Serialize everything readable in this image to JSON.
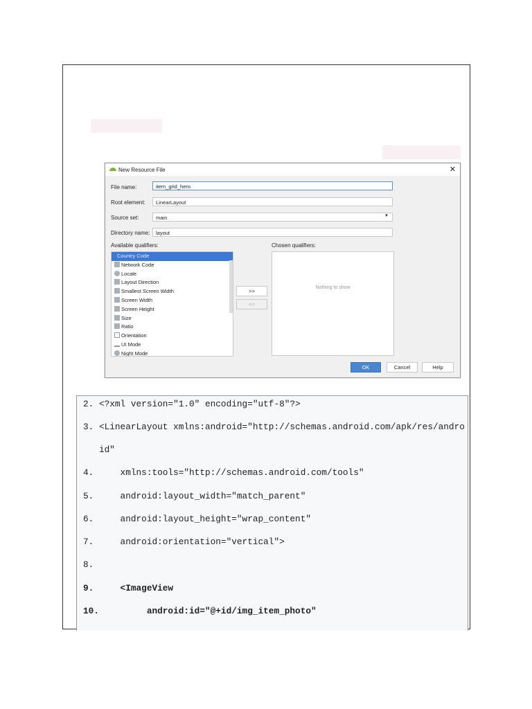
{
  "dialog": {
    "title": "New Resource File",
    "fields": [
      {
        "label": "File name:",
        "value": "item_grid_hero"
      },
      {
        "label": "Root element:",
        "value": "LinearLayout"
      },
      {
        "label": "Source set:",
        "value": "main"
      },
      {
        "label": "Directory name:",
        "value": "layout"
      }
    ],
    "available_label": "Available qualifiers:",
    "chosen_label": "Chosen qualifiers:",
    "qualifiers": [
      "Country Code",
      "Network Code",
      "Locale",
      "Layout Direction",
      "Smallest Screen Width",
      "Screen Width",
      "Screen Height",
      "Size",
      "Ratio",
      "Orientation",
      "UI Mode",
      "Night Mode"
    ],
    "selected_qualifier": "Country Code",
    "add_label": ">>",
    "remove_label": "<<",
    "empty_text": "Nothing to show",
    "ok": "OK",
    "cancel": "Cancel",
    "help": "Help",
    "close": "✕"
  },
  "code_lines": [
    "2. <?xml version=\"1.0\" encoding=\"utf-8\"?>",
    "3. <LinearLayout xmlns:android=\"http://schemas.android.com/apk/res/andro",
    "   id\"",
    "4.     xmlns:tools=\"http://schemas.android.com/tools\"",
    "5.     android:layout_width=\"match_parent\"",
    "6.     android:layout_height=\"wrap_content\"",
    "7.     android:orientation=\"vertical\">",
    "8.",
    "9.     <ImageView",
    "10.         android:id=\"@+id/img_item_photo\""
  ]
}
